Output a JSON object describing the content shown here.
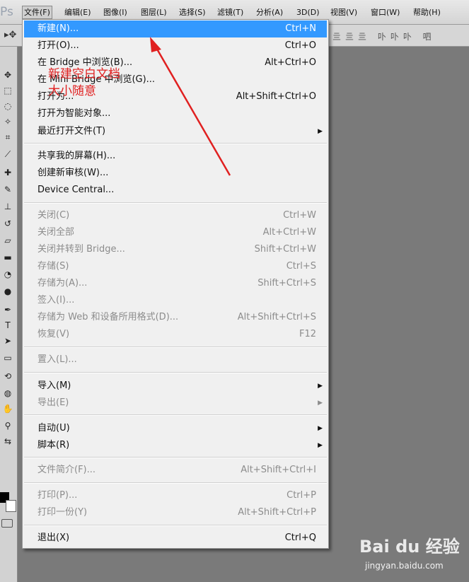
{
  "menubar": {
    "logo": "Ps",
    "items": [
      "文件(F)",
      "编辑(E)",
      "图像(I)",
      "图层(L)",
      "选择(S)",
      "滤镜(T)",
      "分析(A)",
      "3D(D)",
      "视图(V)",
      "窗口(W)",
      "帮助(H)"
    ]
  },
  "optbar": {
    "tool_glyph": "▸✥",
    "icons": "亖亖亖 卟卟卟 呬"
  },
  "file_menu": {
    "items": [
      {
        "label": "新建(N)...",
        "shortcut": "Ctrl+N",
        "highlighted": true
      },
      {
        "label": "打开(O)...",
        "shortcut": "Ctrl+O"
      },
      {
        "label": "在 Bridge 中浏览(B)...",
        "shortcut": "Alt+Ctrl+O"
      },
      {
        "label": "在 Mini Bridge 中浏览(G)...",
        "shortcut": ""
      },
      {
        "label": "打开为...",
        "shortcut": "Alt+Shift+Ctrl+O"
      },
      {
        "label": "打开为智能对象...",
        "shortcut": ""
      },
      {
        "label": "最近打开文件(T)",
        "submenu": true
      },
      {
        "label": "共享我的屏幕(H)...",
        "shortcut": ""
      },
      {
        "label": "创建新审核(W)...",
        "shortcut": ""
      },
      {
        "label": "Device Central...",
        "shortcut": ""
      },
      {
        "label": "关闭(C)",
        "shortcut": "Ctrl+W",
        "disabled": true
      },
      {
        "label": "关闭全部",
        "shortcut": "Alt+Ctrl+W",
        "disabled": true
      },
      {
        "label": "关闭并转到 Bridge...",
        "shortcut": "Shift+Ctrl+W",
        "disabled": true
      },
      {
        "label": "存储(S)",
        "shortcut": "Ctrl+S",
        "disabled": true
      },
      {
        "label": "存储为(A)...",
        "shortcut": "Shift+Ctrl+S",
        "disabled": true
      },
      {
        "label": "签入(I)...",
        "shortcut": "",
        "disabled": true
      },
      {
        "label": "存储为 Web 和设备所用格式(D)...",
        "shortcut": "Alt+Shift+Ctrl+S",
        "disabled": true
      },
      {
        "label": "恢复(V)",
        "shortcut": "F12",
        "disabled": true
      },
      {
        "label": "置入(L)...",
        "shortcut": "",
        "disabled": true
      },
      {
        "label": "导入(M)",
        "submenu": true
      },
      {
        "label": "导出(E)",
        "submenu": true,
        "disabled": true
      },
      {
        "label": "自动(U)",
        "submenu": true
      },
      {
        "label": "脚本(R)",
        "submenu": true
      },
      {
        "label": "文件简介(F)...",
        "shortcut": "Alt+Shift+Ctrl+I",
        "disabled": true
      },
      {
        "label": "打印(P)...",
        "shortcut": "Ctrl+P",
        "disabled": true
      },
      {
        "label": "打印一份(Y)",
        "shortcut": "Alt+Shift+Ctrl+P",
        "disabled": true
      },
      {
        "label": "退出(X)",
        "shortcut": "Ctrl+Q"
      }
    ]
  },
  "annotation": {
    "line1": "新建空白文档",
    "line2": "大小随意",
    "color": "#e02020"
  },
  "watermark": {
    "brand": "Bai du 经验",
    "url": "jingyan.baidu.com"
  },
  "colors": {
    "highlight": "#3399ff",
    "disabled_text": "#8c8c8c"
  }
}
